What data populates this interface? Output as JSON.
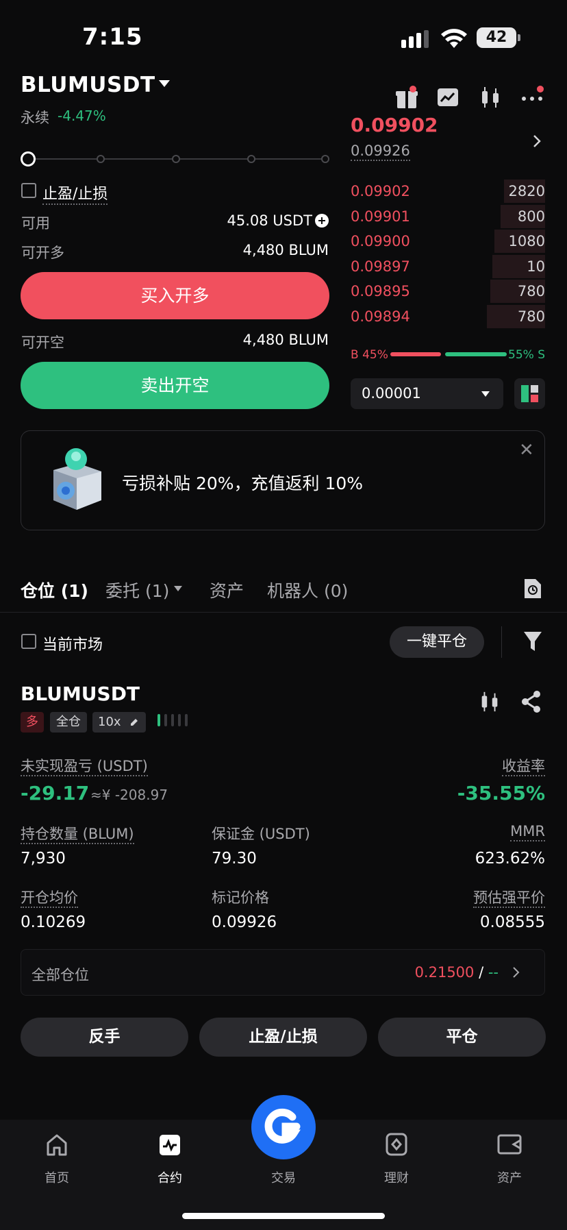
{
  "status_bar": {
    "time": "7:15",
    "battery": "42"
  },
  "header": {
    "pair": "BLUMUSDT",
    "type": "永续",
    "change": "-4.47%"
  },
  "order_form": {
    "tp_sl_label": "止盈/止损",
    "available_label": "可用",
    "available_value": "45.08 USDT",
    "open_long_label": "可开多",
    "open_long_value": "4,480 BLUM",
    "buy_button": "买入开多",
    "open_short_label": "可开空",
    "open_short_value": "4,480 BLUM",
    "sell_button": "卖出开空"
  },
  "order_book": {
    "top_price": "0.09902",
    "mark_price": "0.09926",
    "asks": [
      {
        "price": "0.09902",
        "qty": "2820",
        "depth": 0.21
      },
      {
        "price": "0.09901",
        "qty": "800",
        "depth": 0.23
      },
      {
        "price": "0.09900",
        "qty": "1080",
        "depth": 0.26
      },
      {
        "price": "0.09897",
        "qty": "10",
        "depth": 0.27
      },
      {
        "price": "0.09895",
        "qty": "780",
        "depth": 0.28
      },
      {
        "price": "0.09894",
        "qty": "780",
        "depth": 0.3
      }
    ],
    "buy_ratio": "B 45%",
    "sell_ratio": "55% S",
    "tick_size": "0.00001"
  },
  "banner": {
    "text": "亏损补贴 20%，充值返利 10%"
  },
  "tabs": [
    {
      "label": "仓位 (1)"
    },
    {
      "label": "委托 (1)"
    },
    {
      "label": "资产"
    },
    {
      "label": "机器人 (0)"
    }
  ],
  "filter": {
    "current_market_label": "当前市场",
    "close_all_button": "一键平仓"
  },
  "position": {
    "symbol": "BLUMUSDT",
    "side": "多",
    "margin_mode": "全仓",
    "leverage": "10x",
    "unrealized_label": "未实现盈亏 (USDT)",
    "unrealized_value": "-29.17",
    "unrealized_cny": "≈¥ -208.97",
    "roe_label": "收益率",
    "roe_value": "-35.55%",
    "size_label": "持仓数量 (BLUM)",
    "size_value": "7,930",
    "margin_label": "保证金 (USDT)",
    "margin_value": "79.30",
    "mmr_label": "MMR",
    "mmr_value": "623.62%",
    "entry_label": "开仓均价",
    "entry_value": "0.10269",
    "mark_label": "标记价格",
    "mark_value": "0.09926",
    "liq_label": "预估强平价",
    "liq_value": "0.08555",
    "all_positions_label": "全部仓位",
    "all_positions_value_red": "0.21500",
    "all_positions_sep": " / ",
    "all_positions_value_green": "--"
  },
  "actions": {
    "reverse": "反手",
    "tp_sl": "止盈/止损",
    "close": "平仓"
  },
  "nav": [
    {
      "label": "首页",
      "icon": "home-icon"
    },
    {
      "label": "合约",
      "icon": "futures-icon"
    },
    {
      "label": "交易",
      "icon": "trade-icon"
    },
    {
      "label": "理财",
      "icon": "earn-icon"
    },
    {
      "label": "资产",
      "icon": "wallet-icon"
    }
  ],
  "colors": {
    "red": "#f0505f",
    "green": "#2ec07f",
    "accent": "#1f6ff5",
    "orange": "#f7a26b"
  }
}
